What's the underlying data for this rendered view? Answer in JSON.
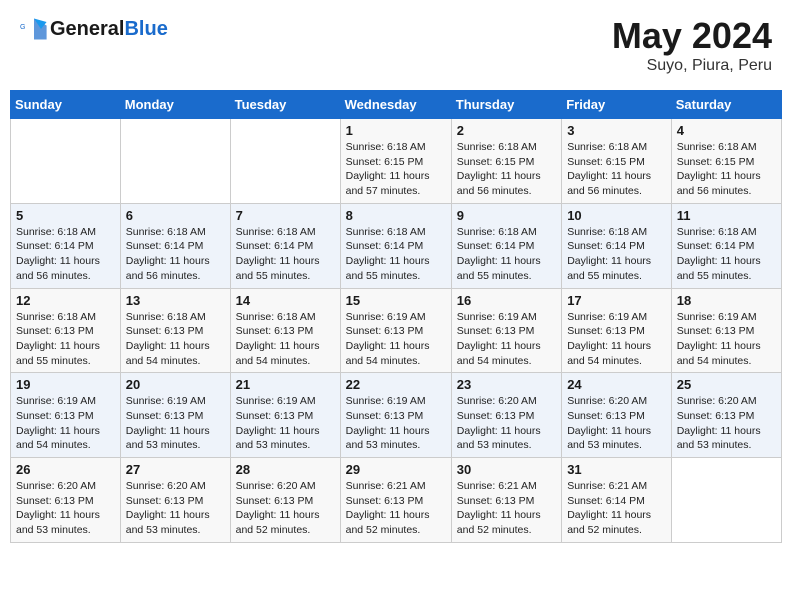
{
  "header": {
    "logo_text_general": "General",
    "logo_text_blue": "Blue",
    "month_year": "May 2024",
    "location": "Suyo, Piura, Peru"
  },
  "columns": [
    "Sunday",
    "Monday",
    "Tuesday",
    "Wednesday",
    "Thursday",
    "Friday",
    "Saturday"
  ],
  "weeks": [
    [
      {
        "day": "",
        "info": ""
      },
      {
        "day": "",
        "info": ""
      },
      {
        "day": "",
        "info": ""
      },
      {
        "day": "1",
        "info": "Sunrise: 6:18 AM\nSunset: 6:15 PM\nDaylight: 11 hours\nand 57 minutes."
      },
      {
        "day": "2",
        "info": "Sunrise: 6:18 AM\nSunset: 6:15 PM\nDaylight: 11 hours\nand 56 minutes."
      },
      {
        "day": "3",
        "info": "Sunrise: 6:18 AM\nSunset: 6:15 PM\nDaylight: 11 hours\nand 56 minutes."
      },
      {
        "day": "4",
        "info": "Sunrise: 6:18 AM\nSunset: 6:15 PM\nDaylight: 11 hours\nand 56 minutes."
      }
    ],
    [
      {
        "day": "5",
        "info": "Sunrise: 6:18 AM\nSunset: 6:14 PM\nDaylight: 11 hours\nand 56 minutes."
      },
      {
        "day": "6",
        "info": "Sunrise: 6:18 AM\nSunset: 6:14 PM\nDaylight: 11 hours\nand 56 minutes."
      },
      {
        "day": "7",
        "info": "Sunrise: 6:18 AM\nSunset: 6:14 PM\nDaylight: 11 hours\nand 55 minutes."
      },
      {
        "day": "8",
        "info": "Sunrise: 6:18 AM\nSunset: 6:14 PM\nDaylight: 11 hours\nand 55 minutes."
      },
      {
        "day": "9",
        "info": "Sunrise: 6:18 AM\nSunset: 6:14 PM\nDaylight: 11 hours\nand 55 minutes."
      },
      {
        "day": "10",
        "info": "Sunrise: 6:18 AM\nSunset: 6:14 PM\nDaylight: 11 hours\nand 55 minutes."
      },
      {
        "day": "11",
        "info": "Sunrise: 6:18 AM\nSunset: 6:14 PM\nDaylight: 11 hours\nand 55 minutes."
      }
    ],
    [
      {
        "day": "12",
        "info": "Sunrise: 6:18 AM\nSunset: 6:13 PM\nDaylight: 11 hours\nand 55 minutes."
      },
      {
        "day": "13",
        "info": "Sunrise: 6:18 AM\nSunset: 6:13 PM\nDaylight: 11 hours\nand 54 minutes."
      },
      {
        "day": "14",
        "info": "Sunrise: 6:18 AM\nSunset: 6:13 PM\nDaylight: 11 hours\nand 54 minutes."
      },
      {
        "day": "15",
        "info": "Sunrise: 6:19 AM\nSunset: 6:13 PM\nDaylight: 11 hours\nand 54 minutes."
      },
      {
        "day": "16",
        "info": "Sunrise: 6:19 AM\nSunset: 6:13 PM\nDaylight: 11 hours\nand 54 minutes."
      },
      {
        "day": "17",
        "info": "Sunrise: 6:19 AM\nSunset: 6:13 PM\nDaylight: 11 hours\nand 54 minutes."
      },
      {
        "day": "18",
        "info": "Sunrise: 6:19 AM\nSunset: 6:13 PM\nDaylight: 11 hours\nand 54 minutes."
      }
    ],
    [
      {
        "day": "19",
        "info": "Sunrise: 6:19 AM\nSunset: 6:13 PM\nDaylight: 11 hours\nand 54 minutes."
      },
      {
        "day": "20",
        "info": "Sunrise: 6:19 AM\nSunset: 6:13 PM\nDaylight: 11 hours\nand 53 minutes."
      },
      {
        "day": "21",
        "info": "Sunrise: 6:19 AM\nSunset: 6:13 PM\nDaylight: 11 hours\nand 53 minutes."
      },
      {
        "day": "22",
        "info": "Sunrise: 6:19 AM\nSunset: 6:13 PM\nDaylight: 11 hours\nand 53 minutes."
      },
      {
        "day": "23",
        "info": "Sunrise: 6:20 AM\nSunset: 6:13 PM\nDaylight: 11 hours\nand 53 minutes."
      },
      {
        "day": "24",
        "info": "Sunrise: 6:20 AM\nSunset: 6:13 PM\nDaylight: 11 hours\nand 53 minutes."
      },
      {
        "day": "25",
        "info": "Sunrise: 6:20 AM\nSunset: 6:13 PM\nDaylight: 11 hours\nand 53 minutes."
      }
    ],
    [
      {
        "day": "26",
        "info": "Sunrise: 6:20 AM\nSunset: 6:13 PM\nDaylight: 11 hours\nand 53 minutes."
      },
      {
        "day": "27",
        "info": "Sunrise: 6:20 AM\nSunset: 6:13 PM\nDaylight: 11 hours\nand 53 minutes."
      },
      {
        "day": "28",
        "info": "Sunrise: 6:20 AM\nSunset: 6:13 PM\nDaylight: 11 hours\nand 52 minutes."
      },
      {
        "day": "29",
        "info": "Sunrise: 6:21 AM\nSunset: 6:13 PM\nDaylight: 11 hours\nand 52 minutes."
      },
      {
        "day": "30",
        "info": "Sunrise: 6:21 AM\nSunset: 6:13 PM\nDaylight: 11 hours\nand 52 minutes."
      },
      {
        "day": "31",
        "info": "Sunrise: 6:21 AM\nSunset: 6:14 PM\nDaylight: 11 hours\nand 52 minutes."
      },
      {
        "day": "",
        "info": ""
      }
    ]
  ]
}
